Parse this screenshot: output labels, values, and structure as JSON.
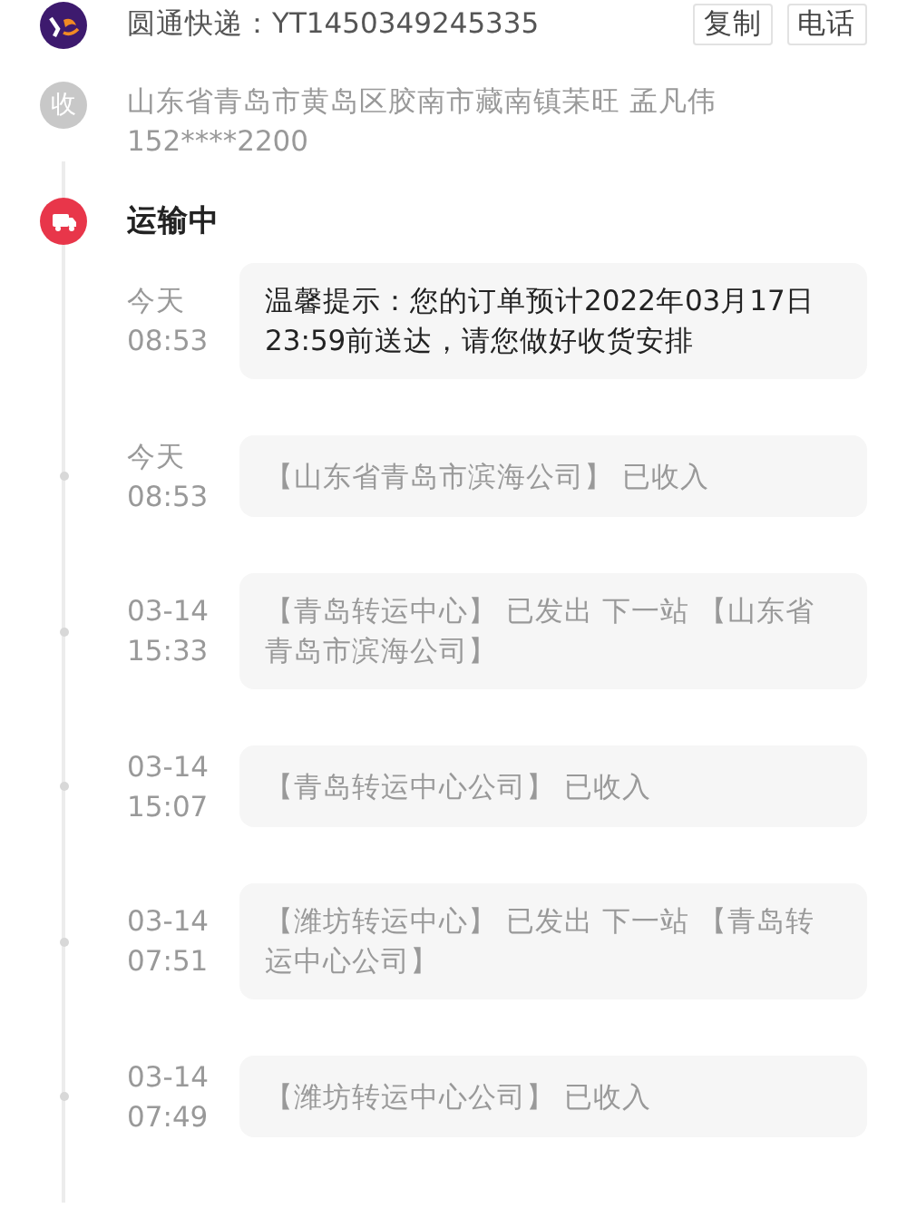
{
  "courier": {
    "name_label": "圆通快递：YT1450349245335",
    "buttons": [
      "复制",
      "电话"
    ]
  },
  "receiver": {
    "badge": "收",
    "address": "山东省青岛市黄岛区胶南市藏南镇苿旺 孟凡伟",
    "phone": "152****2200"
  },
  "status": {
    "label": "运输中"
  },
  "events": [
    {
      "kind": "notice",
      "date": "今天",
      "time": "08:53",
      "text": "温馨提示：您的订单预计2022年03月17日23:59前送达，请您做好收货安排"
    },
    {
      "kind": "scan",
      "date": "今天",
      "time": "08:53",
      "text": "【山东省青岛市滨海公司】 已收入"
    },
    {
      "kind": "scan",
      "date": "03-14",
      "time": "15:33",
      "text": "【青岛转运中心】 已发出 下一站 【山东省青岛市滨海公司】"
    },
    {
      "kind": "scan",
      "date": "03-14",
      "time": "15:07",
      "text": "【青岛转运中心公司】 已收入"
    },
    {
      "kind": "scan",
      "date": "03-14",
      "time": "07:51",
      "text": "【潍坊转运中心】 已发出 下一站 【青岛转运中心公司】"
    },
    {
      "kind": "scan",
      "date": "03-14",
      "time": "07:49",
      "text": "【潍坊转运中心公司】 已收入"
    }
  ]
}
